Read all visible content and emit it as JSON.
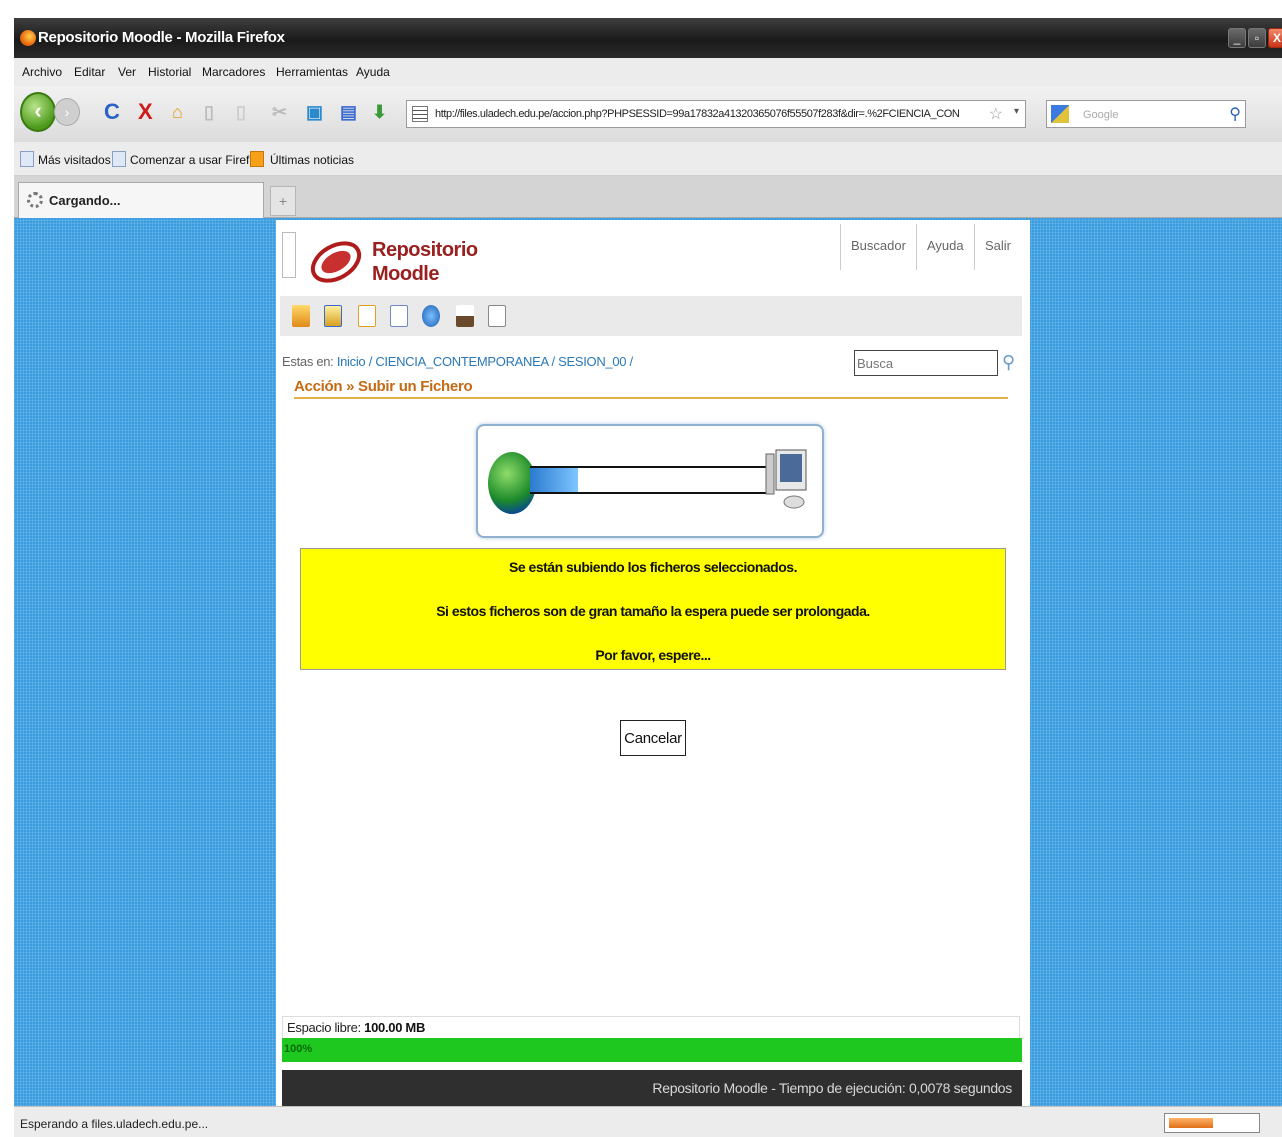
{
  "window": {
    "title": "Repositorio Moodle - Mozilla Firefox",
    "controls": {
      "minimize": "_",
      "maximize": "▫",
      "close": "X"
    }
  },
  "menu": [
    "Archivo",
    "Editar",
    "Ver",
    "Historial",
    "Marcadores",
    "Herramientas",
    "Ayuda"
  ],
  "nav": {
    "url": "http://files.uladech.edu.pe/accion.php?PHPSESSID=99a17832a41320365076f55507f283f&dir=.%2FCIENCIA_CON",
    "search_placeholder": "Google"
  },
  "bookmarks": [
    "Más visitados",
    "Comenzar a usar Firef...",
    "Últimas noticias"
  ],
  "tab": {
    "label": "Cargando...",
    "new_tab": "+"
  },
  "site": {
    "logo_line1": "Repositorio",
    "logo_line2": "Moodle",
    "top_links": [
      "Buscador",
      "Ayuda",
      "Salir"
    ],
    "breadcrumb_prefix": "Estas en:",
    "breadcrumb": [
      "Inicio",
      "CIENCIA_CONTEMPORANEA",
      "SESION_00"
    ],
    "search_placeholder": "Busca",
    "action_title": "Acción » Subir un Fichero",
    "notice_lines": [
      "Se están subiendo los ficheros seleccionados.",
      "Si estos ficheros son de gran tamaño la espera puede ser prolongada.",
      "Por favor, espere..."
    ],
    "cancel_label": "Cancelar",
    "space_label": "Espacio libre:",
    "space_value": "100.00 MB",
    "space_percent_text": "100%",
    "space_fraction": 1.0,
    "upload_progress_fraction": 0.2,
    "footer": "Repositorio Moodle - Tiempo de ejecución: 0,0078 segundos"
  },
  "status": {
    "text": "Esperando a files.uladech.edu.pe..."
  },
  "colors": {
    "notice_bg": "#ffff00",
    "space_fill": "#1ec81e",
    "desktop_bg": "#3a9de0",
    "accent": "#c46a14"
  }
}
